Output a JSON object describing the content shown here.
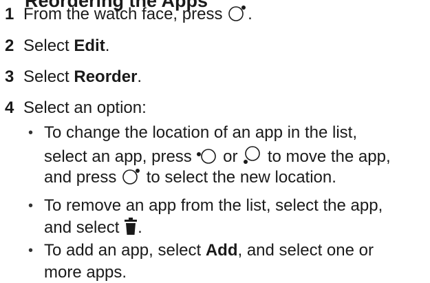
{
  "heading": "Reordering the Apps",
  "steps": [
    {
      "num": "1",
      "text_before": "From the watch face, press",
      "text_after": ".",
      "icon": "watch-button-icon"
    },
    {
      "num": "2",
      "text_before": "Select ",
      "bold": "Edit",
      "text_after": "."
    },
    {
      "num": "3",
      "text_before": "Select ",
      "bold": "Reorder",
      "text_after": "."
    },
    {
      "num": "4",
      "text": "Select an option:"
    }
  ],
  "bullets": [
    {
      "lines": [
        "To change the location of an app in the list,",
        {
          "before": "select an app, press ",
          "middle": " or ",
          "after": " to move the app,"
        },
        {
          "before": "and press ",
          "after": " to select the new location."
        }
      ]
    },
    {
      "lines": [
        "To remove an app from the list, select the app,",
        {
          "before": "and select ",
          "after": "."
        }
      ]
    },
    {
      "lines": [
        {
          "before": "To add an app, select ",
          "bold": "Add",
          "after": ", and select one or"
        },
        "more apps."
      ]
    }
  ],
  "icons": {
    "watch_button": "watch-button-icon",
    "watch_button_left": "watch-button-left-icon",
    "watch_button_bottom": "watch-button-bottom-icon",
    "trash": "trash-icon"
  }
}
